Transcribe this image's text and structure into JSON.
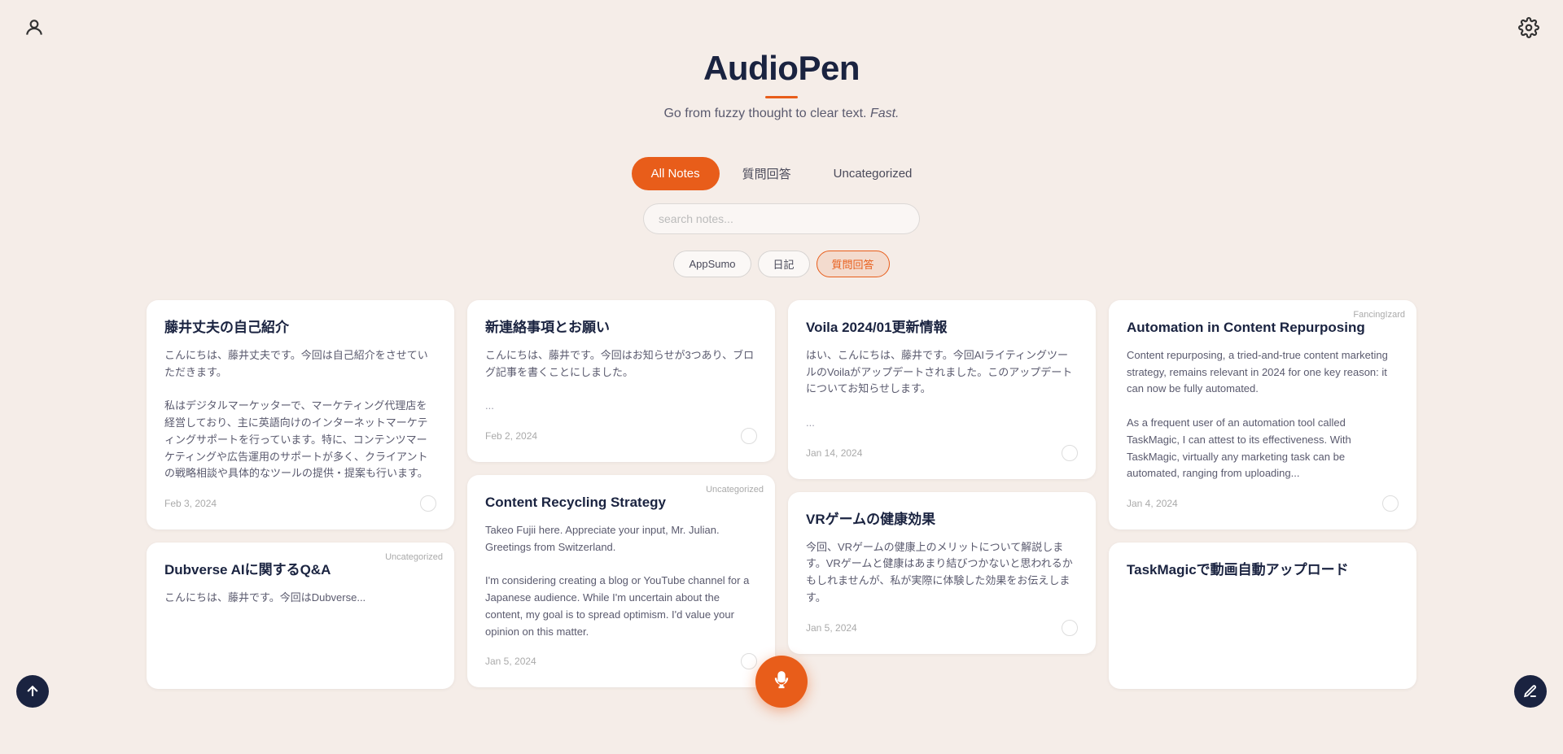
{
  "app": {
    "title": "AudioPen",
    "subtitle_main": "Go from fuzzy thought to clear text.",
    "subtitle_italic": "Fast.",
    "accent_color": "#e85d1a",
    "bg_color": "#f5ede8"
  },
  "tabs": [
    {
      "id": "all-notes",
      "label": "All Notes",
      "active": true
    },
    {
      "id": "qa",
      "label": "質問回答",
      "active": false
    },
    {
      "id": "uncategorized",
      "label": "Uncategorized",
      "active": false
    }
  ],
  "search": {
    "placeholder": "search notes..."
  },
  "filter_tags": [
    {
      "id": "appsumo",
      "label": "AppSumo",
      "active": false
    },
    {
      "id": "diary",
      "label": "日記",
      "active": false
    },
    {
      "id": "qa-tag",
      "label": "質問回答",
      "active": true
    }
  ],
  "notes": [
    {
      "id": "note-1",
      "col": 0,
      "label": "",
      "title": "藤井丈夫の自己紹介",
      "body": "こんにちは、藤井丈夫です。今回は自己紹介をさせていただきます。\n\n私はデジタルマーケッターで、マーケティング代理店を経営しており、主に英語向けのインターネットマーケティングサポートを行っています。特に、コンテンツマーケティングや広告運用のサポートが多く、クライアントの戦略相談や具体的なツールの提供・提案も行います。",
      "date": "Feb 3, 2024",
      "tall": true
    },
    {
      "id": "note-2",
      "col": 1,
      "label": "",
      "title": "新連絡事項とお願い",
      "body": "こんにちは、藤井です。今回はお知らせが3つあり、ブログ記事を書くことにしました。\n\n...",
      "date": "Feb 2, 2024",
      "tall": false
    },
    {
      "id": "note-3",
      "col": 2,
      "label": "",
      "title": "Voila 2024/01更新情報",
      "body": "はい、こんにちは、藤井です。今回AIライティングツールのVoilaがアップデートされました。このアップデートについてお知らせします。\n\n...",
      "date": "Jan 14, 2024",
      "tall": false
    },
    {
      "id": "note-4",
      "col": 3,
      "label": "FancingIzard",
      "title": "Automation in Content Repurposing",
      "body": "Content repurposing, a tried-and-true content marketing strategy, remains relevant in 2024 for one key reason: it can now be fully automated.\n\nAs a frequent user of an automation tool called TaskMagic, I can attest to its effectiveness. With TaskMagic, virtually any marketing task can be automated, ranging from uploading...",
      "date": "Jan 4, 2024",
      "tall": true
    },
    {
      "id": "note-5",
      "col": 1,
      "label": "Uncategorized",
      "title": "Content Recycling Strategy",
      "body": "Takeo Fujii here. Appreciate your input, Mr. Julian. Greetings from Switzerland.\n\nI'm considering creating a blog or YouTube channel for a Japanese audience. While I'm uncertain about the content, my goal is to spread optimism. I'd value your opinion on this matter.",
      "date": "Jan 5, 2024",
      "tall": true
    },
    {
      "id": "note-6",
      "col": 2,
      "label": "",
      "title": "VRゲームの健康効果",
      "body": "今回、VRゲームの健康上のメリットについて解説します。VRゲームと健康はあまり結びつかないと思われるかもしれませんが、私が実際に体験した効果をお伝えします。",
      "date": "Jan 5, 2024",
      "tall": true
    },
    {
      "id": "note-7",
      "col": 0,
      "label": "Uncategorized",
      "title": "Dubverse AIに関するQ&A",
      "body": "こんにちは、藤井です。今回はDubverse...",
      "date": "",
      "tall": false
    },
    {
      "id": "note-8",
      "col": 3,
      "label": "",
      "title": "TaskMagicで動画自動アップロード",
      "body": "",
      "date": "",
      "tall": false
    }
  ],
  "icons": {
    "user": "👤",
    "settings": "⚙",
    "mic": "mic",
    "upload": "↑",
    "edit": "✏"
  }
}
